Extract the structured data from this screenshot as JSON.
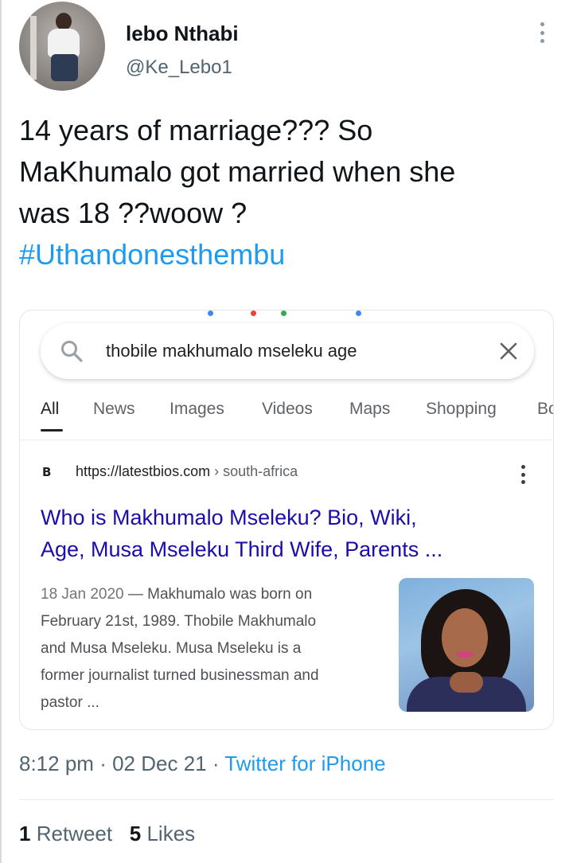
{
  "tweet": {
    "display_name": "lebo Nthabi",
    "handle": "@Ke_Lebo1",
    "text_lines": [
      "14 years of marriage??? So",
      "MaKhumalo got married when she",
      "was 18 ??woow ?"
    ],
    "hashtag": "#Uthandonesthembu",
    "time": "8:12 pm",
    "date": "02 Dec 21",
    "source": "Twitter for iPhone",
    "retweets_count": "1",
    "retweets_label": "Retweet",
    "likes_count": "5",
    "likes_label": "Likes",
    "separator": "·"
  },
  "search": {
    "query": "thobile makhumalo mseleku age",
    "tabs": [
      "All",
      "News",
      "Images",
      "Videos",
      "Maps",
      "Shopping",
      "Bo"
    ],
    "active_tab": "All",
    "result": {
      "favicon": "B",
      "url": "https://latestbios.com",
      "url_path": " › south-africa",
      "title_lines": [
        "Who is Makhumalo Mseleku? Bio, Wiki,",
        "Age, Musa Mseleku Third Wife, Parents ..."
      ],
      "date": "18 Jan 2020",
      "snippet_lines": [
        " — Makhumalo was born on",
        "February 21st, 1989. Thobile Makhumalo",
        "and Musa Mseleku. Musa Mseleku is a",
        "former journalist turned businessman and",
        "pastor ..."
      ]
    }
  },
  "colors": {
    "link_blue": "#1d9bf0",
    "google_title": "#1a0dab",
    "muted": "#536471"
  },
  "icons": {
    "more": "more-vertical-icon",
    "search": "search-icon",
    "close": "close-icon"
  }
}
